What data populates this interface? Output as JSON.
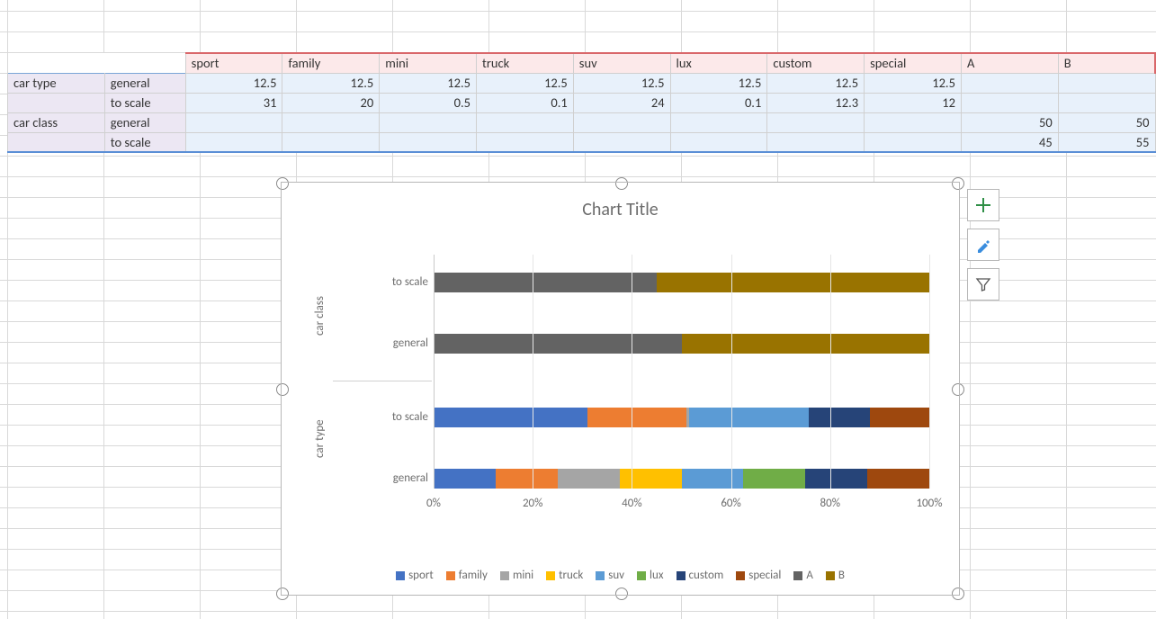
{
  "series_colors": {
    "sport": "#4472c4",
    "family": "#ed7d31",
    "mini": "#a5a5a5",
    "truck": "#ffc000",
    "suv": "#5b9bd5",
    "lux": "#70ad47",
    "custom": "#264478",
    "special": "#9e480e",
    "A": "#636363",
    "B": "#997300"
  },
  "table": {
    "column_headers": [
      "sport",
      "family",
      "mini",
      "truck",
      "suv",
      "lux",
      "custom",
      "special",
      "A",
      "B"
    ],
    "row_groups": [
      {
        "label": "car type",
        "rows": [
          {
            "label": "general",
            "values": [
              "12.5",
              "12.5",
              "12.5",
              "12.5",
              "12.5",
              "12.5",
              "12.5",
              "12.5",
              "",
              ""
            ]
          },
          {
            "label": "to scale",
            "values": [
              "31",
              "20",
              "0.5",
              "0.1",
              "24",
              "0.1",
              "12.3",
              "12",
              "",
              ""
            ]
          }
        ]
      },
      {
        "label": "car class",
        "rows": [
          {
            "label": "general",
            "values": [
              "",
              "",
              "",
              "",
              "",
              "",
              "",
              "",
              "50",
              "50"
            ]
          },
          {
            "label": "to scale",
            "values": [
              "",
              "",
              "",
              "",
              "",
              "",
              "",
              "",
              "45",
              "55"
            ]
          }
        ]
      }
    ]
  },
  "chart_data": {
    "type": "bar",
    "orientation": "horizontal",
    "stacked": "percent",
    "title": "Chart Title",
    "xlabel": "",
    "ylabel": "",
    "xlim": [
      0,
      100
    ],
    "x_ticks": [
      "0%",
      "20%",
      "40%",
      "60%",
      "80%",
      "100%"
    ],
    "category_groups": [
      "car class",
      "car type"
    ],
    "categories": [
      {
        "group": "car class",
        "name": "to scale"
      },
      {
        "group": "car class",
        "name": "general"
      },
      {
        "group": "car type",
        "name": "to scale"
      },
      {
        "group": "car type",
        "name": "general"
      }
    ],
    "series": [
      {
        "name": "sport",
        "values": [
          null,
          null,
          31,
          12.5
        ]
      },
      {
        "name": "family",
        "values": [
          null,
          null,
          20,
          12.5
        ]
      },
      {
        "name": "mini",
        "values": [
          null,
          null,
          0.5,
          12.5
        ]
      },
      {
        "name": "truck",
        "values": [
          null,
          null,
          0.1,
          12.5
        ]
      },
      {
        "name": "suv",
        "values": [
          null,
          null,
          24,
          12.5
        ]
      },
      {
        "name": "lux",
        "values": [
          null,
          null,
          0.1,
          12.5
        ]
      },
      {
        "name": "custom",
        "values": [
          null,
          null,
          12.3,
          12.5
        ]
      },
      {
        "name": "special",
        "values": [
          null,
          null,
          12,
          12.5
        ]
      },
      {
        "name": "A",
        "values": [
          45,
          50,
          null,
          null
        ]
      },
      {
        "name": "B",
        "values": [
          55,
          50,
          null,
          null
        ]
      }
    ],
    "legend": [
      "sport",
      "family",
      "mini",
      "truck",
      "suv",
      "lux",
      "custom",
      "special",
      "A",
      "B"
    ]
  },
  "side_buttons": [
    "plus",
    "brush",
    "funnel"
  ]
}
